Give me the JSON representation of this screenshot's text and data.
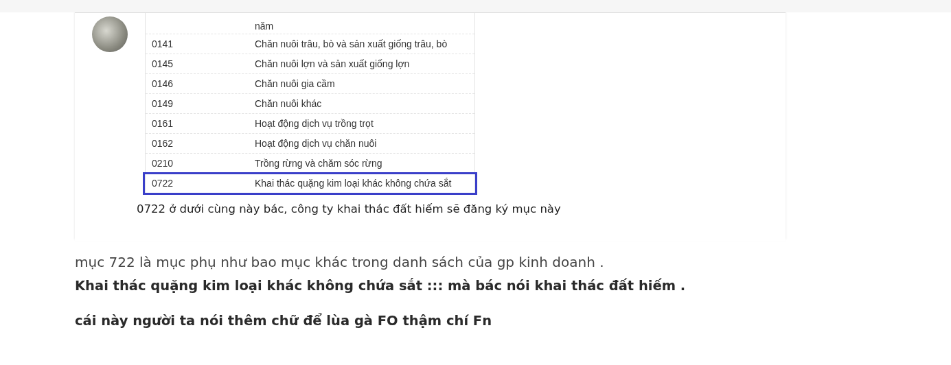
{
  "quoted_image": {
    "table": {
      "rows": [
        {
          "code": "",
          "activity": "năm",
          "selected": false
        },
        {
          "code": "0141",
          "activity": "Chăn nuôi trâu, bò và sản xuất giống trâu, bò",
          "selected": false
        },
        {
          "code": "0145",
          "activity": "Chăn nuôi lợn và sản xuất giống lợn",
          "selected": false
        },
        {
          "code": "0146",
          "activity": "Chăn nuôi gia cầm",
          "selected": false
        },
        {
          "code": "0149",
          "activity": "Chăn nuôi khác",
          "selected": false
        },
        {
          "code": "0161",
          "activity": "Hoạt động dịch vụ trồng trọt",
          "selected": false
        },
        {
          "code": "0162",
          "activity": "Hoạt động dịch vụ chăn nuôi",
          "selected": false
        },
        {
          "code": "0210",
          "activity": "Trồng rừng và chăm sóc rừng",
          "selected": false
        },
        {
          "code": "0722",
          "activity": "Khai thác quặng kim loại khác không chứa sắt",
          "selected": true
        }
      ]
    },
    "caption": "0722 ở dưới cùng này bác, công ty khai thác đất hiếm sẽ đăng ký mục này"
  },
  "post": [
    {
      "text": "mục 722 là mục phụ như bao mục khác trong danh sách của gp kinh doanh .",
      "bold": false
    },
    {
      "text": "Khai thác quặng kim loại khác không chứa sắt ::: mà bác nói khai thác đất hiếm .",
      "bold": true
    },
    {
      "text": "cái này người ta nói thêm chữ để lùa gà FO thậm chí Fn",
      "bold": true
    }
  ]
}
